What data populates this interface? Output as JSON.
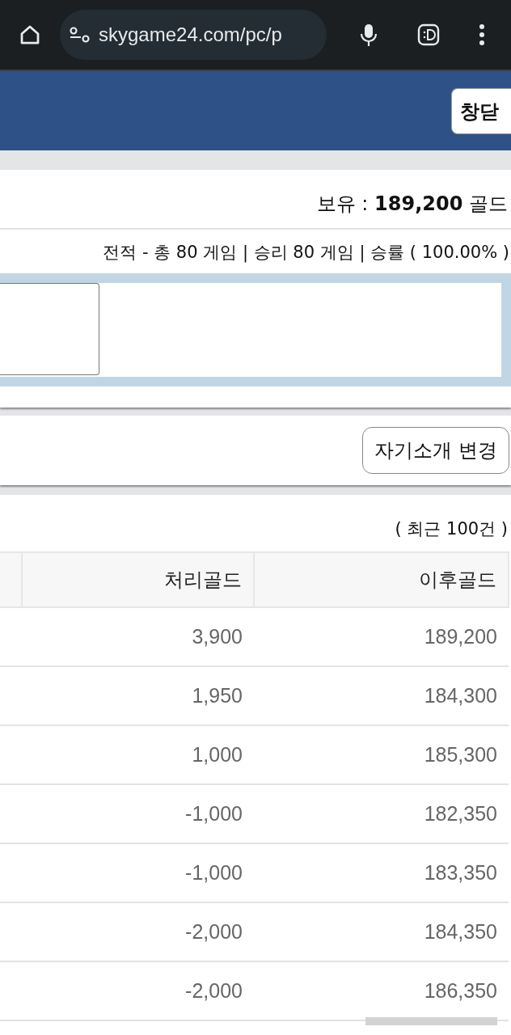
{
  "browser": {
    "url": "skygame24.com/pc/p"
  },
  "header": {
    "button": "창닫"
  },
  "holdings": {
    "label": "보유 : ",
    "amount": "189,200",
    "unit": " 골드"
  },
  "record": "전적 - 총 80 게임 | 승리 80 게임 | 승률 ( 100.00% )",
  "intro_button": "자기소개 변경",
  "history": {
    "note": "( 최근 100건 )",
    "columns": [
      "처리골드",
      "이후골드"
    ],
    "rows": [
      {
        "processed": "3,900",
        "after": "189,200"
      },
      {
        "processed": "1,950",
        "after": "184,300"
      },
      {
        "processed": "1,000",
        "after": "185,300"
      },
      {
        "processed": "-1,000",
        "after": "182,350"
      },
      {
        "processed": "-1,000",
        "after": "183,350"
      },
      {
        "processed": "-2,000",
        "after": "184,350"
      },
      {
        "processed": "-2,000",
        "after": "186,350"
      }
    ]
  }
}
